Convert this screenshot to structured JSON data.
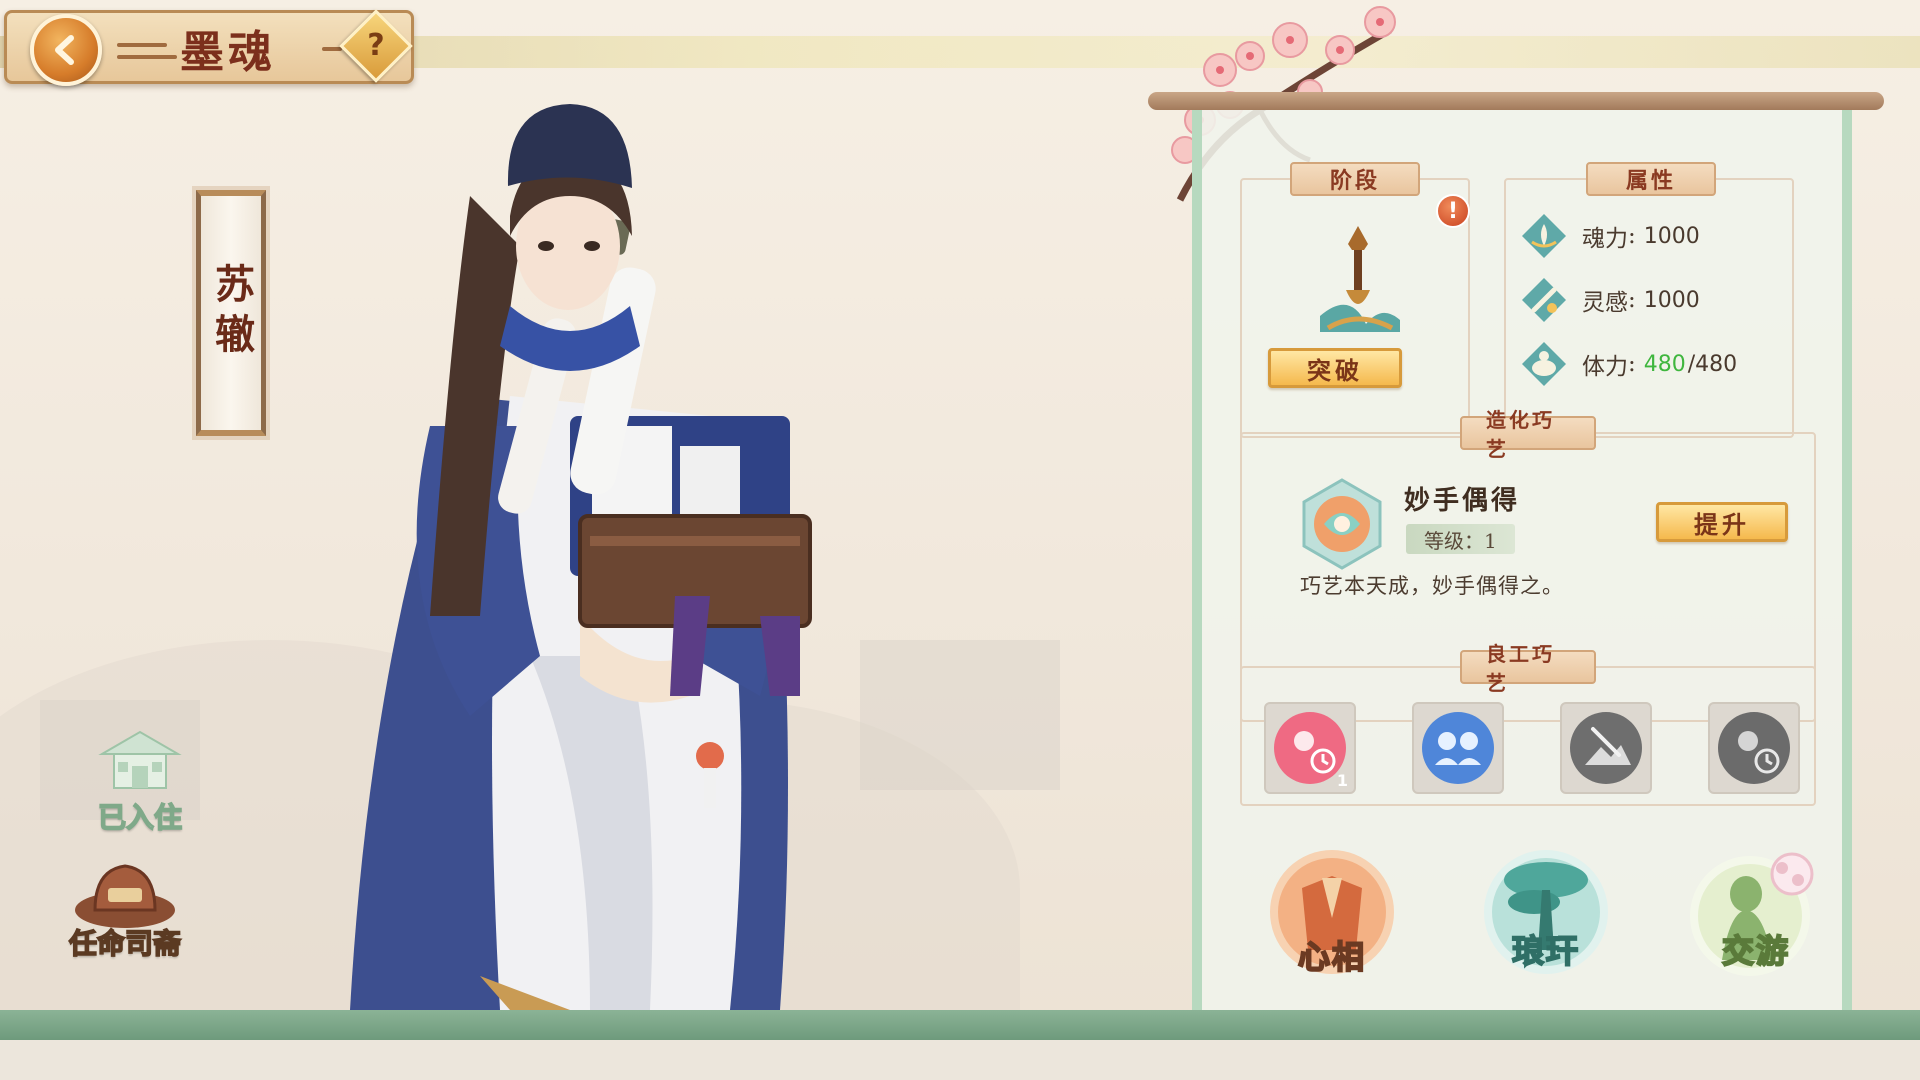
{
  "header": {
    "title": "墨魂",
    "back_icon": "chevron-left-icon",
    "help_label": "?"
  },
  "character": {
    "name": "苏辙"
  },
  "side_buttons": {
    "residence_label": "已入住",
    "appoint_label": "任命司斋"
  },
  "stage": {
    "label": "阶段",
    "alert": "!",
    "breakthrough_label": "突破"
  },
  "attributes": {
    "label": "属性",
    "items": [
      {
        "name": "魂力",
        "value": "1000",
        "icon": "soul-power-icon"
      },
      {
        "name": "灵感",
        "value": "1000",
        "icon": "inspiration-icon"
      },
      {
        "name": "体力",
        "value": "480",
        "max": "/480",
        "icon": "stamina-icon"
      }
    ]
  },
  "creation_craft": {
    "label": "造化巧艺",
    "skill_name": "妙手偶得",
    "level_text": "等级：1",
    "description": "巧艺本天成，妙手偶得之。",
    "upgrade_label": "提升"
  },
  "fine_craft": {
    "label": "良工巧艺",
    "slots": [
      {
        "icon": "flower-timer-icon",
        "count": "1",
        "active": true
      },
      {
        "icon": "companions-icon",
        "count": "",
        "active": true
      },
      {
        "icon": "brush-mountain-icon",
        "count": "",
        "active": false
      },
      {
        "icon": "flower-timer-icon",
        "count": "",
        "active": false
      }
    ]
  },
  "nav": {
    "heart_label": "心相",
    "langgan_label": "琅玕",
    "social_label": "交游"
  },
  "colors": {
    "accent_gold": "#f5b94d",
    "title_red": "#7c2f1c",
    "jade_green": "#b7d9bf",
    "stamina_green": "#3fb63e"
  }
}
